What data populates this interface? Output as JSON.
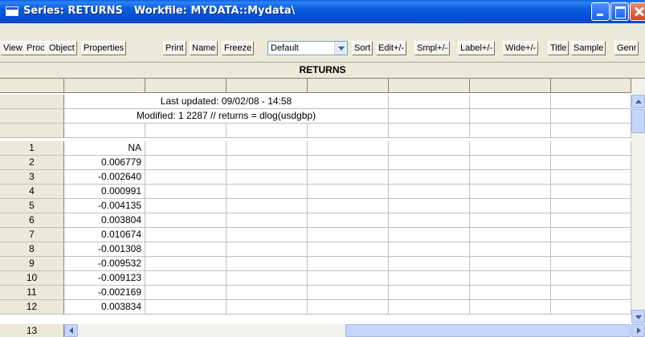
{
  "window": {
    "title_prefix": "Series: RETURNS",
    "title_workfile": "Workfile: MYDATA::Mydata\\"
  },
  "toolbar": {
    "buttons": [
      "View",
      "Proc",
      "Object",
      "Properties",
      "Print",
      "Name",
      "Freeze",
      "Sort",
      "Edit+/-",
      "Smpl+/-",
      "Label+/-",
      "Wide+/-",
      "Title",
      "Sample",
      "Genr"
    ],
    "display_format": "Default"
  },
  "sheet": {
    "header": "RETURNS",
    "info_line1": "Last updated: 09/02/08 - 14:58",
    "info_line2": "Modified: 1 2287 // returns = dlog(usdgbp)",
    "rows": [
      {
        "obs": "1",
        "value": "NA"
      },
      {
        "obs": "2",
        "value": "0.006779"
      },
      {
        "obs": "3",
        "value": "-0.002640"
      },
      {
        "obs": "4",
        "value": "0.000991"
      },
      {
        "obs": "5",
        "value": "-0.004135"
      },
      {
        "obs": "6",
        "value": "0.003804"
      },
      {
        "obs": "7",
        "value": "0.010674"
      },
      {
        "obs": "8",
        "value": "-0.001308"
      },
      {
        "obs": "9",
        "value": "-0.009532"
      },
      {
        "obs": "10",
        "value": "-0.009123"
      },
      {
        "obs": "11",
        "value": "-0.002169"
      },
      {
        "obs": "12",
        "value": "0.003834"
      },
      {
        "obs": "13",
        "value": ""
      }
    ]
  }
}
